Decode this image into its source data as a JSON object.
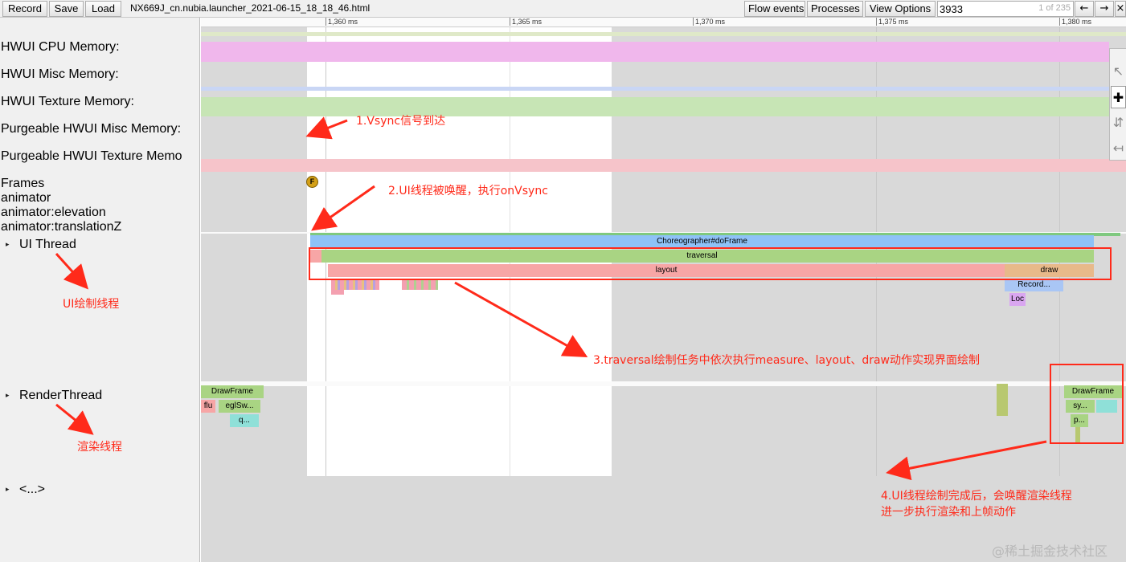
{
  "toolbar": {
    "record": "Record",
    "save": "Save",
    "load": "Load",
    "filename": "NX669J_cn.nubia.launcher_2021-06-15_18_18_46.html",
    "flow_events": "Flow events",
    "processes": "Processes",
    "view_options": "View Options",
    "search_value": "3933",
    "search_count": "1 of 235",
    "prev": "←",
    "next": "→",
    "close": "×"
  },
  "ruler": [
    "1,360 ms",
    "1,365 ms",
    "1,370 ms",
    "1,375 ms",
    "1,380 ms"
  ],
  "tracks": {
    "hwui_cpu": "HWUI CPU Memory:",
    "hwui_misc": "HWUI Misc Memory:",
    "hwui_texture": "HWUI Texture Memory:",
    "purge_misc": "Purgeable HWUI Misc Memory:",
    "purge_texture": "Purgeable HWUI Texture Memo",
    "frames": "Frames",
    "animator": "animator",
    "animator_elev": "animator:elevation",
    "animator_tz": "animator:translationZ",
    "ui_thread": "UI Thread",
    "render_thread": "RenderThread",
    "other": "<...>",
    "expand_glyph": "▸"
  },
  "frame_marker": "F",
  "slices": {
    "choreographer": "Choreographer#doFrame",
    "traversal": "traversal",
    "layout": "layout",
    "draw": "draw",
    "record": "Record...",
    "loc": "Loc",
    "drawframe_left": "DrawFrame",
    "flu": "flu",
    "eglsw": "eglSw...",
    "q": "q...",
    "drawframe_right": "DrawFrame",
    "sy": "sy...",
    "p": "p..."
  },
  "annotations": {
    "n1": "1.Vsync信号到达",
    "n2": "2.UI线程被唤醒，执行onVsync",
    "ui_label": "UI绘制线程",
    "n3": "3.traversal绘制任务中依次执行measure、layout、draw动作实现界面绘制",
    "render_label": "渲染线程",
    "n4a": "4.UI线程绘制完成后，会唤醒渲染线程",
    "n4b": "进一步执行渲染和上帧动作"
  },
  "palette_icons": [
    "pointer-icon",
    "move-icon",
    "zoom-icon",
    "timing-icon"
  ],
  "watermark": "@稀土掘金技术社区",
  "colors": {
    "annotation": "#ff2a1a",
    "choreographer": "#8ec2f7",
    "traversal": "#a9d483",
    "layout": "#f7a6a6",
    "draw": "#e8b98a"
  }
}
